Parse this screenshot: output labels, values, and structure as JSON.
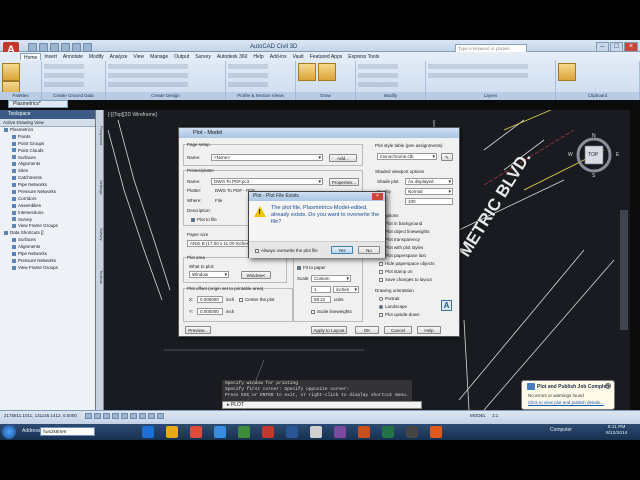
{
  "app": {
    "window_title": "AutoCAD Civil 3D",
    "search_placeholder": "Type a keyword or phrase"
  },
  "ribbon": {
    "tabs": [
      "Home",
      "Insert",
      "Annotate",
      "Modify",
      "Analyze",
      "View",
      "Manage",
      "Output",
      "Survey",
      "Autodesk 360",
      "Help",
      "Add-ins",
      "Vault",
      "Featured Apps",
      "Express Tools"
    ],
    "active_tab": "Home",
    "panel_labels": [
      "Palettes",
      "Create Ground Data",
      "Create Design",
      "Profile & Section Views",
      "Draw",
      "Modify",
      "Layers",
      "Clipboard"
    ]
  },
  "document_tab": "Plasmetrics*",
  "viewport_label": "[-][Top][2D Wireframe]",
  "toolspace": {
    "title": "Toolspace",
    "view_label": "Active Drawing View",
    "items": [
      "Plasmetrics",
      "Points",
      "Point Groups",
      "Point Clouds",
      "Surfaces",
      "Alignments",
      "Sites",
      "Catchments",
      "Pipe Networks",
      "Pressure Networks",
      "Corridors",
      "Assemblies",
      "Intersections",
      "Survey",
      "View Frame Groups",
      "Data Shortcuts []",
      "Surfaces",
      "Alignments",
      "Pipe Networks",
      "Pressure Networks",
      "View Frame Groups"
    ],
    "side_tabs": [
      "Prospector",
      "Settings",
      "Survey",
      "Toolbox"
    ]
  },
  "drawing": {
    "street_label": "METRIC BLVD.",
    "viewcube": {
      "top": "TOP",
      "n": "N",
      "w": "W",
      "e": "E",
      "s": "S"
    }
  },
  "plot_dialog": {
    "title": "Plot - Model",
    "page_setup_label": "Page setup",
    "name_label": "Name:",
    "page_setup_value": "<None>",
    "add_label": "Add...",
    "printer_label": "Printer/plotter",
    "printer_name_label": "Name:",
    "printer_value": "DWG To PDF.pc3",
    "properties_label": "Properties...",
    "plotter_label": "Plotter:",
    "plotter_value": "DWG To PDF - PDF",
    "where_label": "Where:",
    "where_value": "File",
    "description_label": "Description:",
    "plot_to_file": "Plot to file",
    "paper_size_label": "Paper size",
    "paper_size_value": "ANSI B (17.00 x 11.00 Inches)",
    "plot_area_label": "Plot area",
    "what_to_plot_label": "What to plot:",
    "what_to_plot_value": "Window",
    "window_button": "Window<",
    "plot_offset_label": "Plot offset (origin set to printable area)",
    "x_label": "X:",
    "x_value": "0.000000",
    "y_label": "Y:",
    "y_value": "0.000000",
    "offset_unit": "inch",
    "center_plot": "Center the plot",
    "fit_to_paper": "Fit to paper",
    "scale_label": "Scale:",
    "scale_value": "Custom",
    "scale_num": "1",
    "scale_unit": "inches",
    "scale_den": "58.22",
    "scale_units_label": "units",
    "scale_lineweights": "Scale lineweights",
    "preview_button": "Preview...",
    "apply_layout_button": "Apply to Layout",
    "ok_button": "OK",
    "cancel_button": "Cancel",
    "help_button": "Help",
    "style_table_label": "Plot style table (pen assignments)",
    "style_table_value": "monochrome.ctb",
    "shaded_label": "Shaded viewport options",
    "shade_plot_label": "Shade plot",
    "shade_plot_value": "As displayed",
    "quality_label": "Quality",
    "quality_value": "Normal",
    "dpi_label": "DPI",
    "dpi_value": "100",
    "plot_options_label": "Plot options",
    "options": [
      {
        "label": "Plot in background",
        "checked": false
      },
      {
        "label": "Plot object lineweights",
        "checked": true
      },
      {
        "label": "Plot transparency",
        "checked": false
      },
      {
        "label": "Plot with plot styles",
        "checked": true
      },
      {
        "label": "Plot paperspace last",
        "checked": true
      },
      {
        "label": "Hide paperspace objects",
        "checked": false
      },
      {
        "label": "Plot stamp on",
        "checked": false
      },
      {
        "label": "Save changes to layout",
        "checked": false
      }
    ],
    "orientation_label": "Drawing orientation",
    "portrait": "Portrait",
    "landscape": "Landscape",
    "upside_down": "Plot upside-down"
  },
  "confirm_dialog": {
    "title": "Plot - Plot File Exists",
    "message": "The plot file, Plasmetrics-Model-edited, already exists. Do you want to overwrite the file?",
    "always_overwrite": "Always overwrite the plot file",
    "yes_button": "Yes",
    "no_button": "No"
  },
  "command": {
    "history": [
      "Specify window for printing",
      "Specify first corner: Specify opposite corner:",
      "Press ESC or ENTER to exit, or right-click to display shortcut menu."
    ],
    "prompt": "PLOT"
  },
  "status": {
    "coords": "2175811.1011, 131145.1412, 0.0000",
    "model_label": "MODEL",
    "scale": "1:1"
  },
  "notification": {
    "title": "Plot and Publish Job Complete",
    "text": "No errors or warnings found",
    "link": "Click to view plot and publish details..."
  },
  "taskbar": {
    "address_label": "Address",
    "address_value": "\\\\ws2k8rte9",
    "computer_label": "Computer",
    "time": "6:11 PM",
    "date": "8/12/2014"
  }
}
